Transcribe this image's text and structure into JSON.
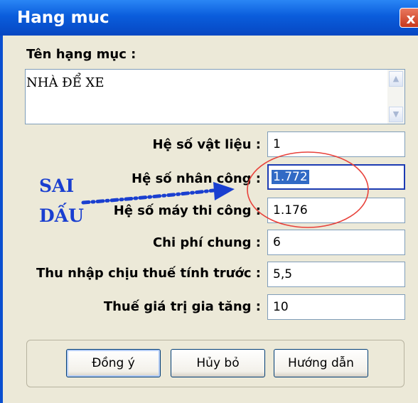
{
  "window": {
    "title": "Hang muc",
    "close_glyph": "x"
  },
  "form": {
    "name_label": "Tên hạng mục :",
    "name_value": "NHÀ ĐỂ XE",
    "fields": [
      {
        "label": "Hệ số vật liệu :",
        "value": "1"
      },
      {
        "label": "Hệ số nhân công :",
        "value": "1.772"
      },
      {
        "label": "Hệ số máy thi công :",
        "value": "1.176"
      },
      {
        "label": "Chi phí chung :",
        "value": "6"
      },
      {
        "label": "Thu nhập chịu thuế tính trước :",
        "value": "5,5"
      },
      {
        "label": "Thuế giá trị gia tăng :",
        "value": "10"
      }
    ]
  },
  "buttons": {
    "ok": "Đồng ý",
    "cancel": "Hủy bỏ",
    "help": "Hướng dẫn"
  },
  "annotation": {
    "line1": "SAI",
    "line2": "DẤU",
    "color": "#1a3fd0",
    "circle_color": "#e8413a"
  },
  "scroll_glyphs": {
    "up": "▲",
    "down": "▼"
  }
}
